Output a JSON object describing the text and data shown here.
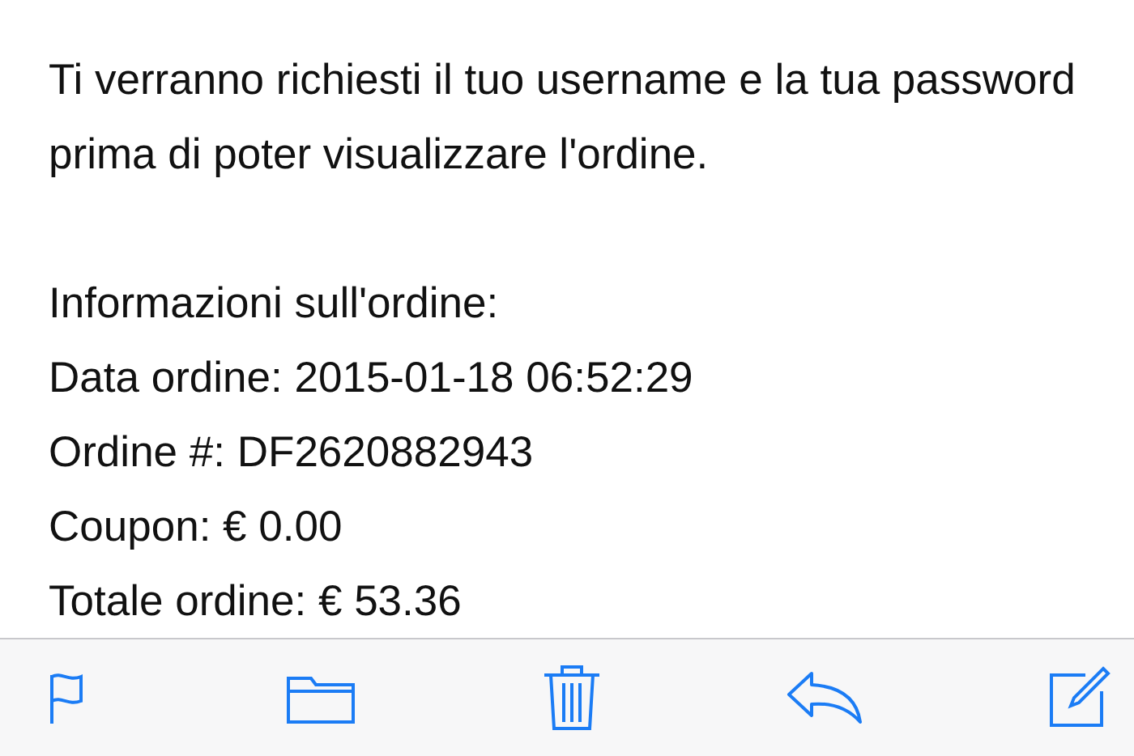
{
  "message": {
    "intro": "Ti verranno richiesti il tuo username e la tua password prima di poter visualizzare l'ordine.",
    "details": [
      "Informazioni sull'ordine:",
      "Data ordine: 2015-01-18 06:52:29",
      "Ordine #: DF2620882943",
      "Coupon: € 0.00",
      "Totale ordine: € 53.36"
    ]
  },
  "toolbar": [
    {
      "kind": "flag"
    },
    {
      "kind": "folder"
    },
    {
      "kind": "trash"
    },
    {
      "kind": "reply"
    },
    {
      "kind": "compose"
    }
  ]
}
